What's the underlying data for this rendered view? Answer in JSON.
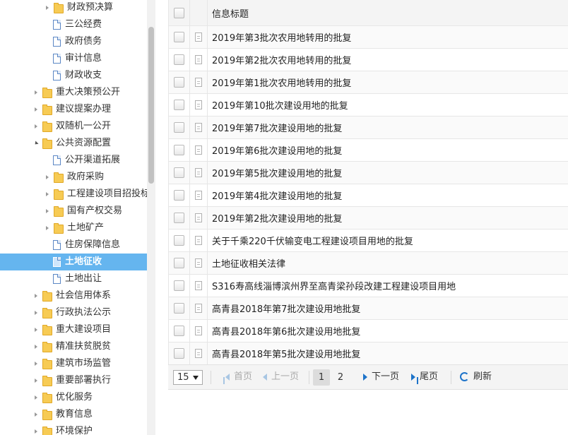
{
  "tree": {
    "items": [
      {
        "label": "财政预决算",
        "type": "folder",
        "level": 2,
        "expanded": false,
        "selected": false
      },
      {
        "label": "三公经费",
        "type": "doc",
        "level": 2,
        "selected": false
      },
      {
        "label": "政府债务",
        "type": "doc",
        "level": 2,
        "selected": false
      },
      {
        "label": "审计信息",
        "type": "doc",
        "level": 2,
        "selected": false
      },
      {
        "label": "财政收支",
        "type": "doc",
        "level": 2,
        "selected": false
      },
      {
        "label": "重大决策预公开",
        "type": "folder",
        "level": 1,
        "expanded": false,
        "selected": false
      },
      {
        "label": "建议提案办理",
        "type": "folder",
        "level": 1,
        "expanded": false,
        "selected": false
      },
      {
        "label": "双随机一公开",
        "type": "folder",
        "level": 1,
        "expanded": false,
        "selected": false
      },
      {
        "label": "公共资源配置",
        "type": "folder",
        "level": 1,
        "expanded": true,
        "selected": false
      },
      {
        "label": "公开渠道拓展",
        "type": "doc",
        "level": 2,
        "selected": false
      },
      {
        "label": "政府采购",
        "type": "folder",
        "level": 2,
        "expanded": false,
        "selected": false
      },
      {
        "label": "工程建设项目招投标",
        "type": "folder",
        "level": 2,
        "expanded": false,
        "selected": false
      },
      {
        "label": "国有产权交易",
        "type": "folder",
        "level": 2,
        "expanded": false,
        "selected": false
      },
      {
        "label": "土地矿产",
        "type": "folder",
        "level": 2,
        "expanded": false,
        "selected": false
      },
      {
        "label": "住房保障信息",
        "type": "doc",
        "level": 2,
        "selected": false
      },
      {
        "label": "土地征收",
        "type": "doc",
        "level": 2,
        "selected": true
      },
      {
        "label": "土地出让",
        "type": "doc",
        "level": 2,
        "selected": false
      },
      {
        "label": "社会信用体系",
        "type": "folder",
        "level": 1,
        "expanded": false,
        "selected": false
      },
      {
        "label": "行政执法公示",
        "type": "folder",
        "level": 1,
        "expanded": false,
        "selected": false
      },
      {
        "label": "重大建设项目",
        "type": "folder",
        "level": 1,
        "expanded": false,
        "selected": false
      },
      {
        "label": "精准扶贫脱贫",
        "type": "folder",
        "level": 1,
        "expanded": false,
        "selected": false
      },
      {
        "label": "建筑市场监管",
        "type": "folder",
        "level": 1,
        "expanded": false,
        "selected": false
      },
      {
        "label": "重要部署执行",
        "type": "folder",
        "level": 1,
        "expanded": false,
        "selected": false
      },
      {
        "label": "优化服务",
        "type": "folder",
        "level": 1,
        "expanded": false,
        "selected": false
      },
      {
        "label": "教育信息",
        "type": "folder",
        "level": 1,
        "expanded": false,
        "selected": false
      },
      {
        "label": "环境保护",
        "type": "folder",
        "level": 1,
        "expanded": false,
        "selected": false
      }
    ]
  },
  "grid": {
    "header_title": "信息标题",
    "rows": [
      "2019年第3批次农用地转用的批复",
      "2019年第2批次农用地转用的批复",
      "2019年第1批次农用地转用的批复",
      "2019年第10批次建设用地的批复",
      "2019年第7批次建设用地的批复",
      "2019年第6批次建设用地的批复",
      "2019年第5批次建设用地的批复",
      "2019年第4批次建设用地的批复",
      "2019年第2批次建设用地的批复",
      "关于千乘220千伏输变电工程建设项目用地的批复",
      "土地征收相关法律",
      "S316寿高线淄博滨州界至高青梁孙段改建工程建设项目用地",
      "高青县2018年第7批次建设用地批复",
      "高青县2018年第6批次建设用地批复",
      "高青县2018年第5批次建设用地批复"
    ]
  },
  "pager": {
    "page_size": "15",
    "first": "首页",
    "prev": "上一页",
    "pages": [
      "1",
      "2"
    ],
    "current_page": "1",
    "next": "下一页",
    "last": "尾页",
    "refresh": "刷新"
  }
}
